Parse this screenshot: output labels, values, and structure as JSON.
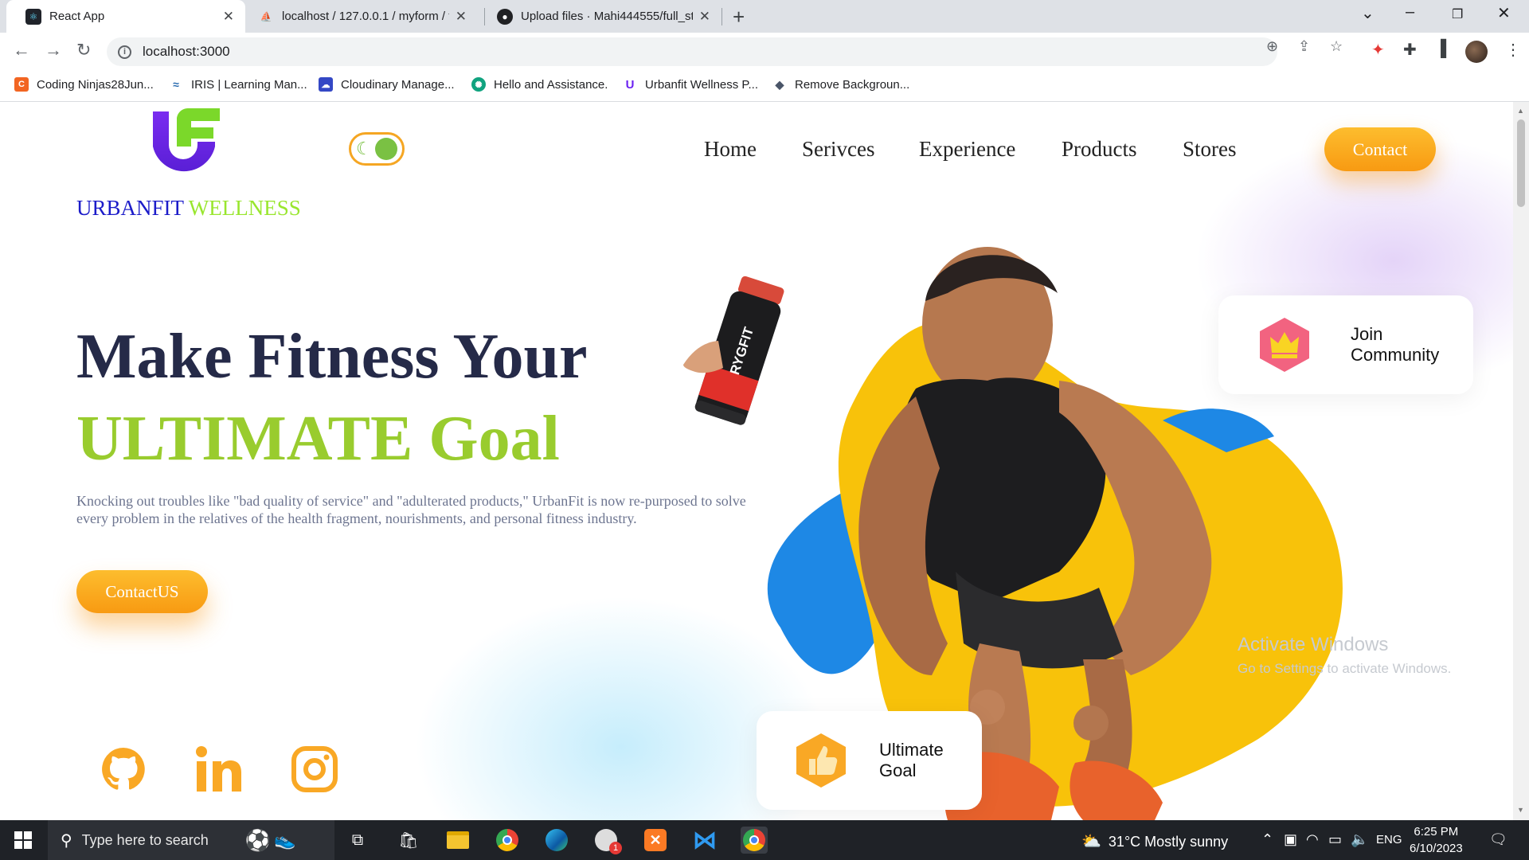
{
  "browser": {
    "tabs": [
      {
        "title": "React App",
        "favicon": "react-icon",
        "active": true
      },
      {
        "title": "localhost / 127.0.0.1 / myform / f",
        "favicon": "phpmyadmin-icon",
        "active": false
      },
      {
        "title": "Upload files · Mahi444555/full_st",
        "favicon": "github-icon",
        "active": false
      }
    ],
    "url": "localhost:3000",
    "bookmarks": [
      {
        "label": "Coding Ninjas28Jun...",
        "icon": "coding-ninjas-icon",
        "color": "#f26522"
      },
      {
        "label": "IRIS | Learning Man...",
        "icon": "iris-icon",
        "color": "#2b6cb0"
      },
      {
        "label": "Cloudinary Manage...",
        "icon": "cloudinary-icon",
        "color": "#3448c5"
      },
      {
        "label": "Hello and Assistance.",
        "icon": "chatgpt-icon",
        "color": "#10a37f"
      },
      {
        "label": "Urbanfit Wellness P...",
        "icon": "urbanfit-icon",
        "color": "#6b21f2"
      },
      {
        "label": "Remove Backgroun...",
        "icon": "removebg-icon",
        "color": "#4a5568"
      }
    ]
  },
  "site": {
    "brand_part1": "URBANFIT",
    "brand_part2": "WELLNESS",
    "nav": [
      "Home",
      "Serivces",
      "Experience",
      "Products",
      "Stores"
    ],
    "contact_label": "Contact",
    "headline_line1": "Make Fitness Your",
    "headline_line2": "ULTIMATE Goal",
    "description": "Knocking out troubles like \"bad quality of service\" and \"adulterated products,\" UrbanFit is now re-purposed to solve every problem in the relatives of the health fragment, nourishments, and personal fitness industry.",
    "cta_label": "ContactUS",
    "shaker_text": "RYGFIT",
    "social": [
      "github-icon",
      "linkedin-icon",
      "instagram-icon"
    ],
    "card_community_line1": "Join",
    "card_community_line2": "Community",
    "card_goal_line1": "Ultimate",
    "card_goal_line2": "Goal",
    "colors": {
      "accent_orange": "#f9a825",
      "brand_blue": "#1c1cc9",
      "brand_green": "#99e62e",
      "headline_dark": "#252a48",
      "headline_green": "#99cc2e",
      "blob_yellow": "#f8c20a",
      "blob_blue": "#1e88e5"
    }
  },
  "windows": {
    "watermark_title": "Activate Windows",
    "watermark_sub": "Go to Settings to activate Windows.",
    "search_placeholder": "Type here to search",
    "weather": "31°C  Mostly sunny",
    "lang": "ENG",
    "time": "6:25 PM",
    "date": "6/10/2023",
    "chat_badge": "1"
  }
}
